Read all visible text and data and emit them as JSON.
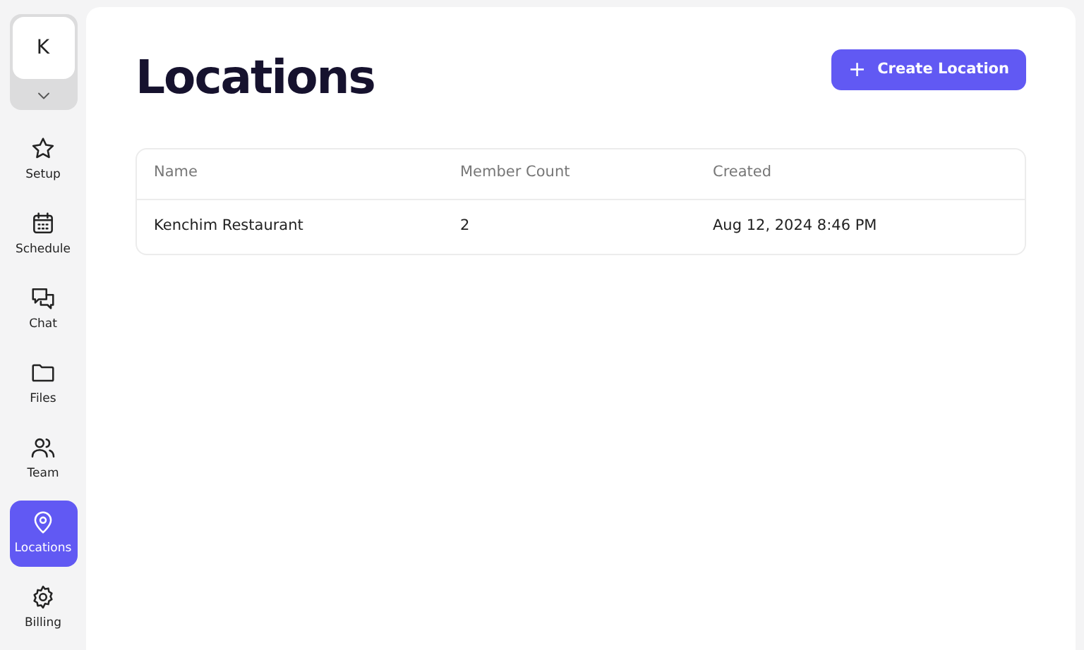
{
  "workspace": {
    "initial": "K",
    "expanded": false
  },
  "nav": [
    {
      "kind": "star",
      "label": "Setup",
      "selected": false
    },
    {
      "kind": "calendar",
      "label": "Schedule",
      "selected": false
    },
    {
      "kind": "chat",
      "label": "Chat",
      "selected": false
    },
    {
      "kind": "folder",
      "label": "Files",
      "selected": false
    },
    {
      "kind": "team",
      "label": "Team",
      "selected": false
    },
    {
      "kind": "pin",
      "label": "Locations",
      "selected": true
    },
    {
      "kind": "gear",
      "label": "Billing",
      "selected": false
    }
  ],
  "page": {
    "title": "Locations",
    "action": {
      "icon": "+",
      "label": "Create Location"
    }
  },
  "table": {
    "columns": [
      "Name",
      "Member Count",
      "Created"
    ],
    "rows": [
      [
        "Kenchim Restaurant",
        "2",
        "Aug 12, 2024 8:46 PM"
      ]
    ]
  }
}
